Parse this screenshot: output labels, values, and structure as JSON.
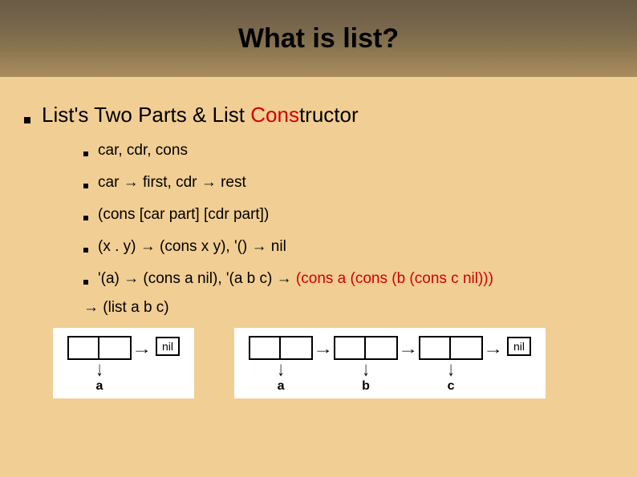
{
  "title": "What is list?",
  "heading_plain": "List's Two Parts & List ",
  "heading_red": "Cons",
  "heading_tail": "tructor",
  "bullets": [
    "car, cdr, cons",
    "car → first, cdr → rest",
    "(cons [car part] [cdr part])",
    "(x . y) → (cons x y), '() → nil"
  ],
  "bullet5_plain": "'(a) → (cons a nil), '(a b c) → ",
  "bullet5_red": "(cons a (cons (b (cons c nil)))",
  "tail_line": "→ (list a b c)",
  "diagram1": {
    "labels": [
      "a"
    ],
    "nil": "nil"
  },
  "diagram2": {
    "labels": [
      "a",
      "b",
      "c"
    ],
    "nil": "nil"
  }
}
